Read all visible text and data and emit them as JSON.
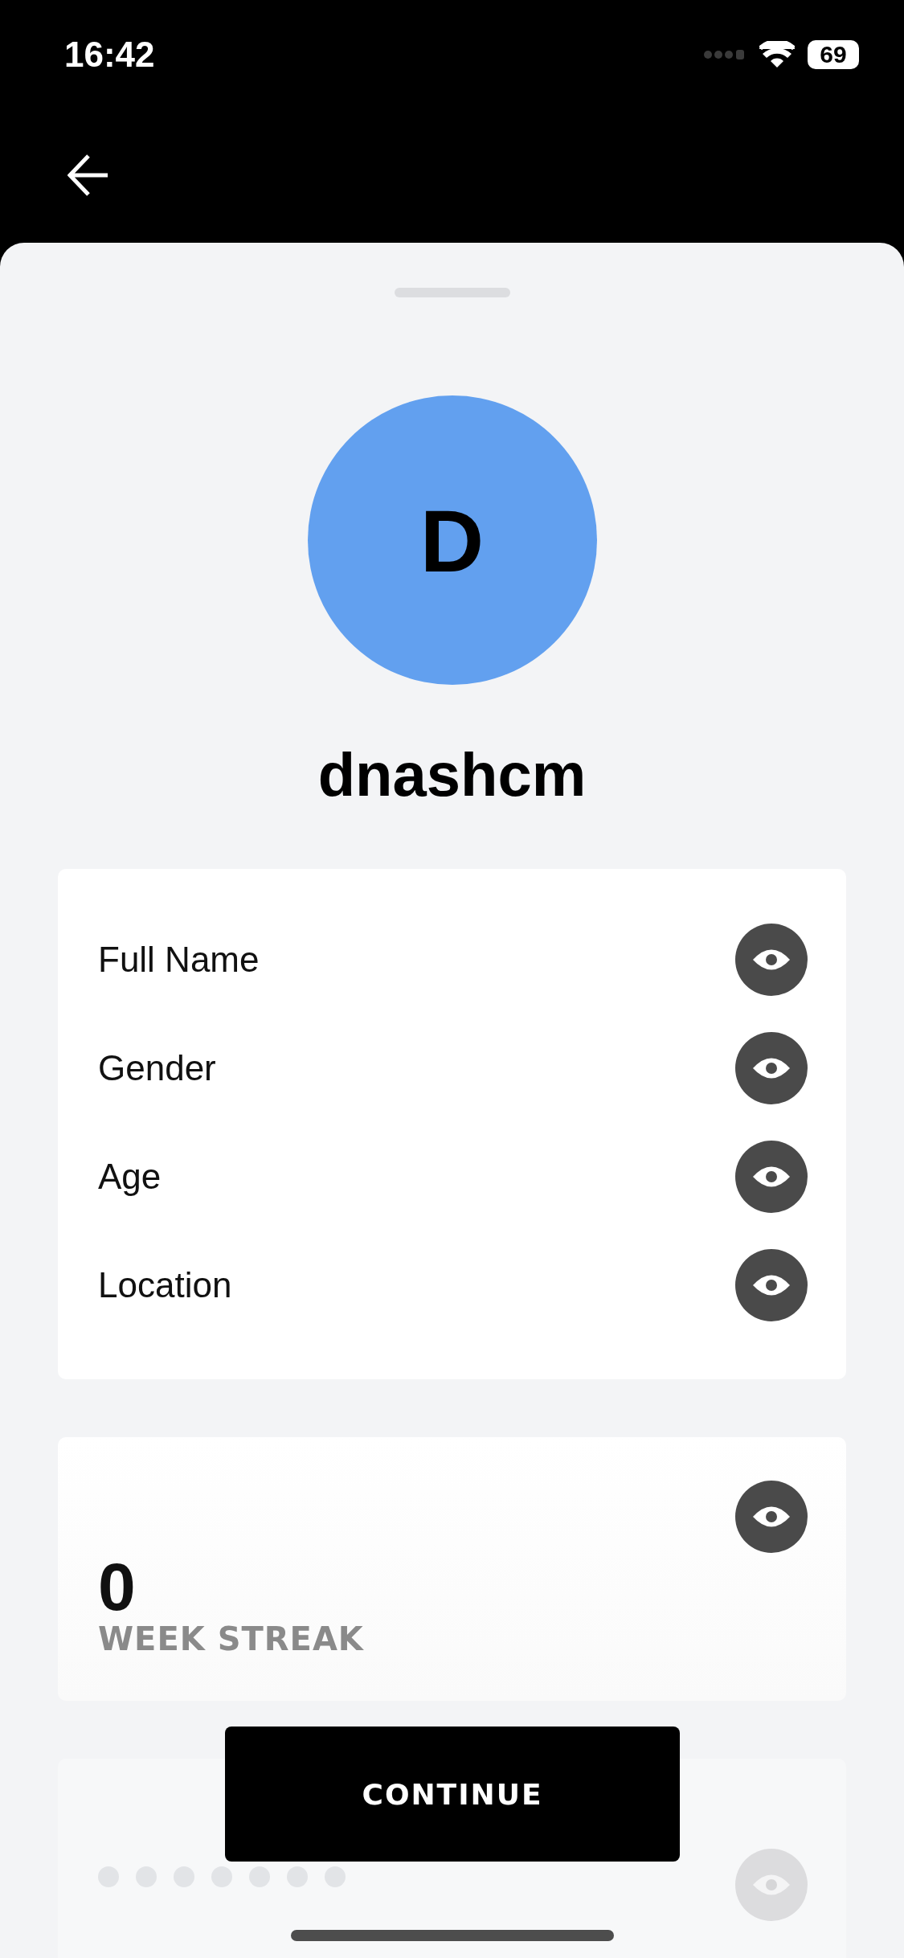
{
  "status_bar": {
    "time": "16:42",
    "battery": "69"
  },
  "profile": {
    "initial": "D",
    "username": "dnashcm"
  },
  "details": [
    {
      "label": "Full Name"
    },
    {
      "label": "Gender"
    },
    {
      "label": "Age"
    },
    {
      "label": "Location"
    }
  ],
  "streak": {
    "value": "0",
    "label": "WEEK STREAK"
  },
  "continue_button": "CONTINUE"
}
